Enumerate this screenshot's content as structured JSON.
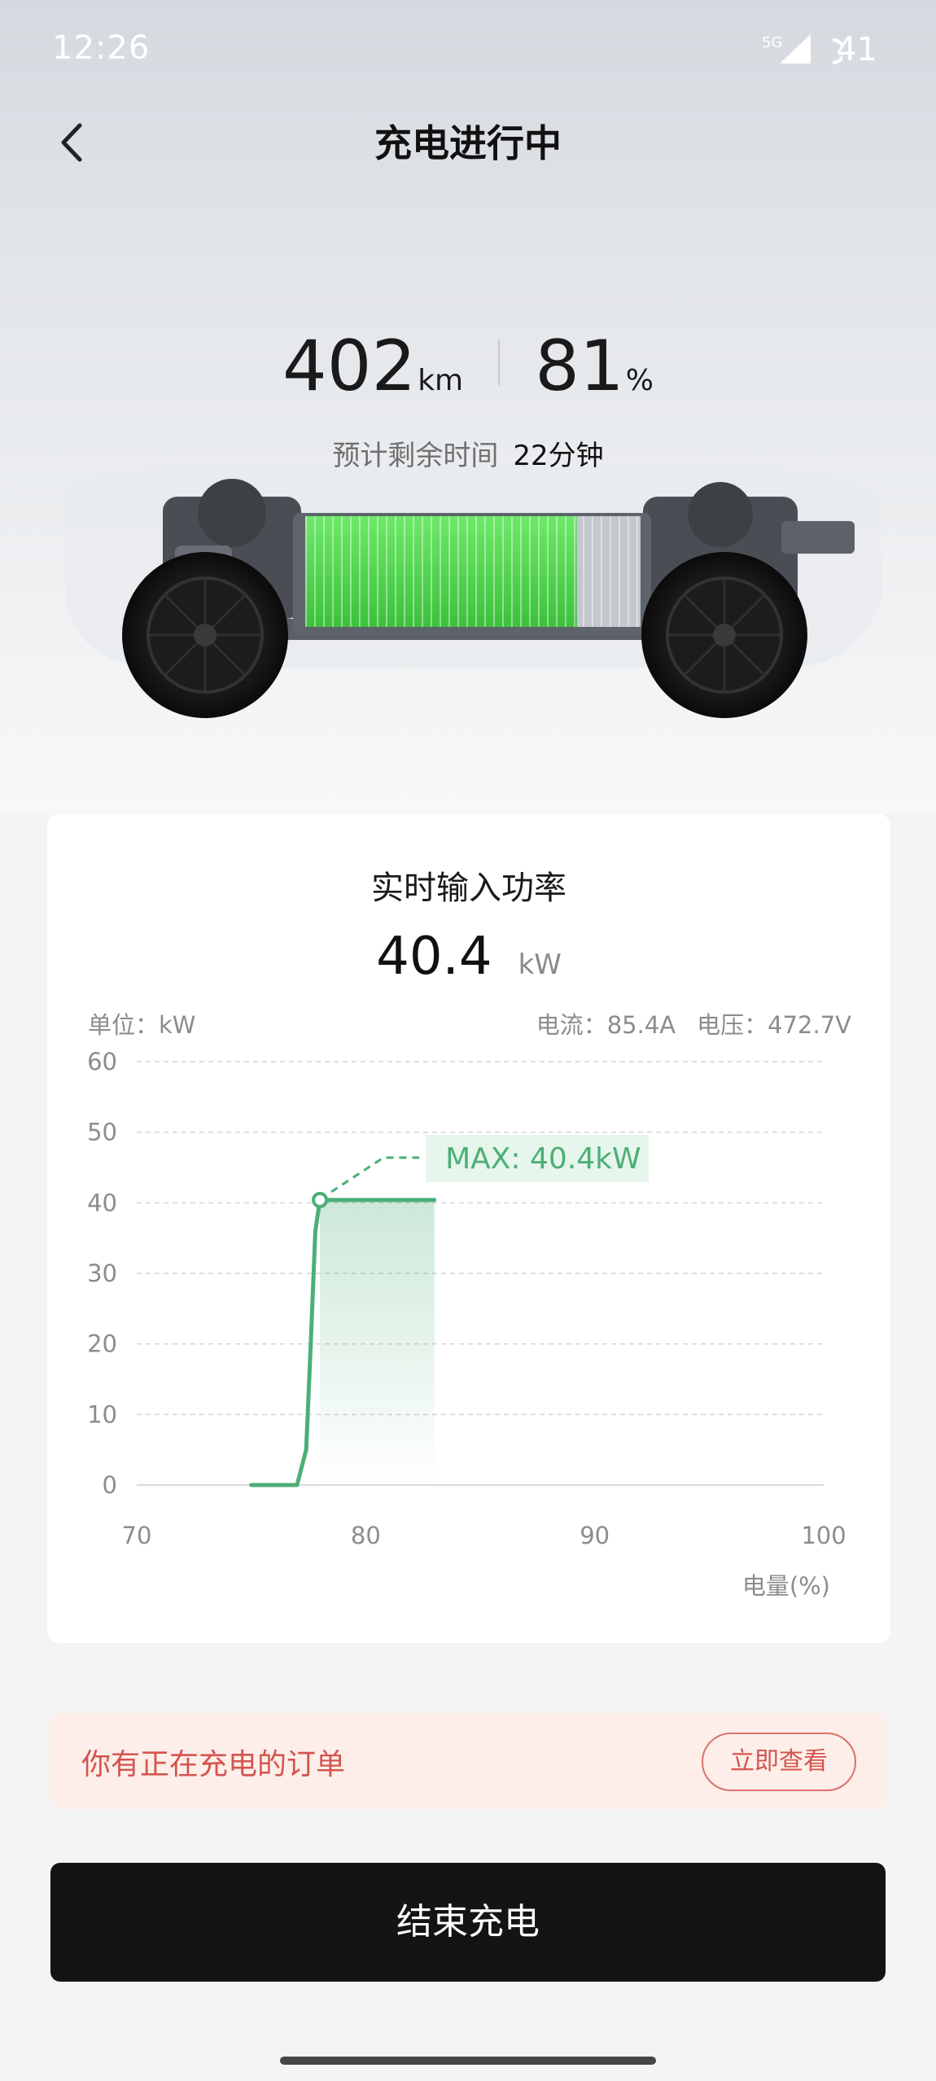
{
  "status_bar": {
    "time": "12:26",
    "network": "5G",
    "battery": "41"
  },
  "header": {
    "title": "充电进行中"
  },
  "summary": {
    "range_value": "402",
    "range_unit": "km",
    "soc_value": "81",
    "soc_unit": "%",
    "eta_label": "预计剩余时间",
    "eta_value": "22分钟",
    "battery_fill_fraction": 0.81
  },
  "power_card": {
    "title": "实时输入功率",
    "power_value": "40.4",
    "power_unit": "kW",
    "unit_label": "单位：kW",
    "current": "电流：85.4A",
    "voltage": "电压：472.7V"
  },
  "chart_data": {
    "type": "line",
    "x_label": "电量(%)",
    "xlim": [
      70,
      100
    ],
    "ylim": [
      0,
      60
    ],
    "x_ticks": [
      70,
      80,
      90,
      100
    ],
    "y_ticks": [
      0,
      10,
      20,
      30,
      40,
      50,
      60
    ],
    "grid": true,
    "series": [
      {
        "x": [
          75,
          76,
          77,
          77.4,
          77.6,
          77.8,
          78,
          80,
          83
        ],
        "y": [
          0,
          0,
          0,
          5,
          20,
          36,
          40.4,
          40.4,
          40.4
        ]
      }
    ],
    "max_annotation": {
      "x": 78,
      "y": 40.4,
      "text": "MAX: 40.4kW"
    },
    "colors": {
      "line": "#4caf76",
      "max_label_bg": "#e6f6ec"
    }
  },
  "order_banner": {
    "text": "你有正在充电的订单",
    "button": "立即查看"
  },
  "actions": {
    "end_charge": "结束充电"
  }
}
